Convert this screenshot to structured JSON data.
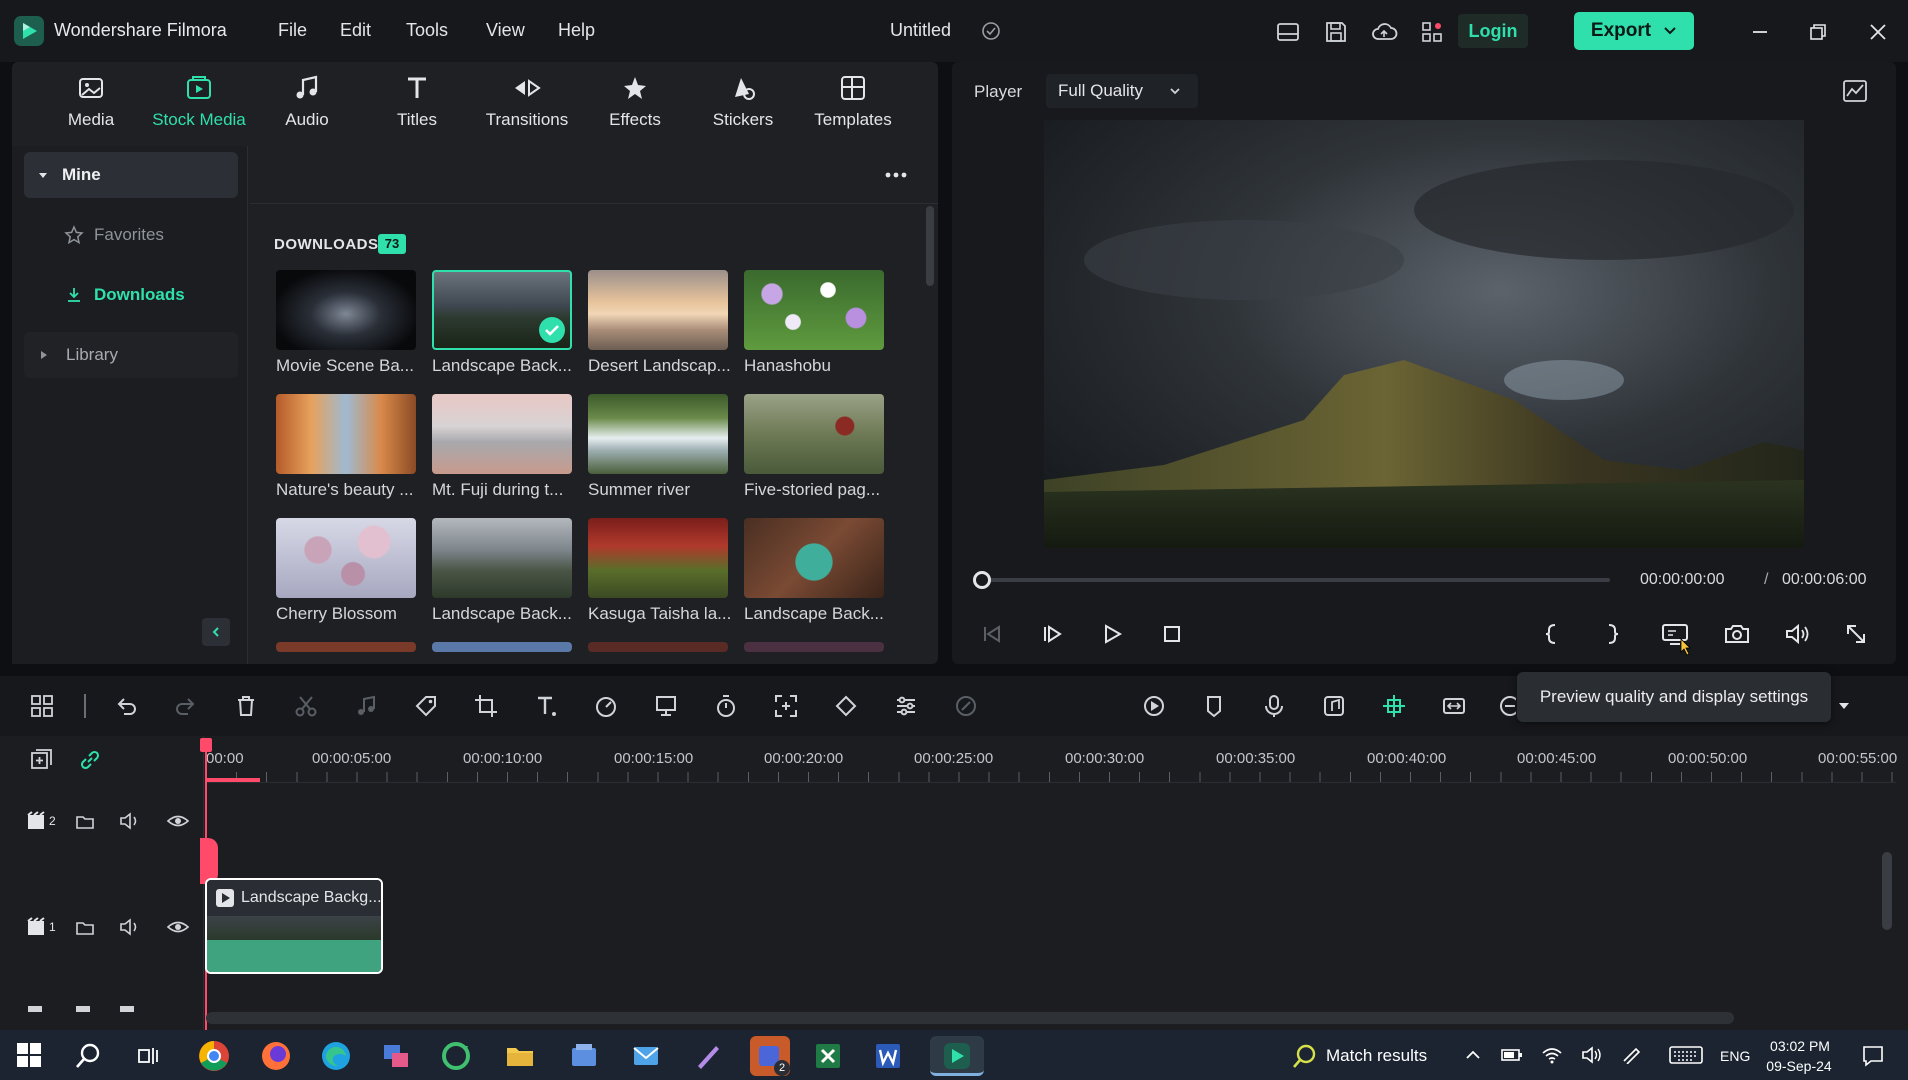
{
  "titlebar": {
    "app_name": "Wondershare Filmora",
    "menu": [
      "File",
      "Edit",
      "Tools",
      "View",
      "Help"
    ],
    "project_title": "Untitled",
    "login_label": "Login",
    "export_label": "Export"
  },
  "media_tabs": [
    {
      "label": "Media",
      "icon": "media-icon"
    },
    {
      "label": "Stock Media",
      "icon": "stock-media-icon",
      "active": true
    },
    {
      "label": "Audio",
      "icon": "music-note-icon"
    },
    {
      "label": "Titles",
      "icon": "titles-icon"
    },
    {
      "label": "Transitions",
      "icon": "transitions-icon"
    },
    {
      "label": "Effects",
      "icon": "effects-icon"
    },
    {
      "label": "Stickers",
      "icon": "stickers-icon"
    },
    {
      "label": "Templates",
      "icon": "templates-icon"
    }
  ],
  "sidebar": {
    "mine": "Mine",
    "favorites": "Favorites",
    "downloads": "Downloads",
    "library": "Library"
  },
  "downloads": {
    "heading": "DOWNLOADS",
    "count": "73",
    "items": [
      {
        "label": "Movie Scene Ba..."
      },
      {
        "label": "Landscape Back...",
        "selected": true
      },
      {
        "label": "Desert Landscap..."
      },
      {
        "label": "Hanashobu"
      },
      {
        "label": "Nature's beauty ..."
      },
      {
        "label": "Mt. Fuji during t..."
      },
      {
        "label": "Summer river"
      },
      {
        "label": "Five-storied pag..."
      },
      {
        "label": "Cherry Blossom"
      },
      {
        "label": "Landscape Back..."
      },
      {
        "label": "Kasuga Taisha la..."
      },
      {
        "label": "Landscape Back..."
      }
    ]
  },
  "player": {
    "label": "Player",
    "quality": "Full Quality",
    "current_time": "00:00:00:00",
    "separator": "/",
    "total_time": "00:00:06:00",
    "tooltip": "Preview quality and display settings"
  },
  "timeline": {
    "ruler": [
      "00:00",
      "00:00:05:00",
      "00:00:10:00",
      "00:00:15:00",
      "00:00:20:00",
      "00:00:25:00",
      "00:00:30:00",
      "00:00:35:00",
      "00:00:40:00",
      "00:00:45:00",
      "00:00:50:00",
      "00:00:55:00"
    ],
    "track2_num": "2",
    "track1_num": "1",
    "clip_label": "Landscape Backg..."
  },
  "taskbar": {
    "match_results": "Match results",
    "lang": "ENG",
    "time": "03:02 PM",
    "date": "09-Sep-24",
    "teams_badge": "2"
  },
  "colors": {
    "accent": "#2fe0ac",
    "playhead": "#ff4a6a",
    "background": "#1e2024"
  }
}
